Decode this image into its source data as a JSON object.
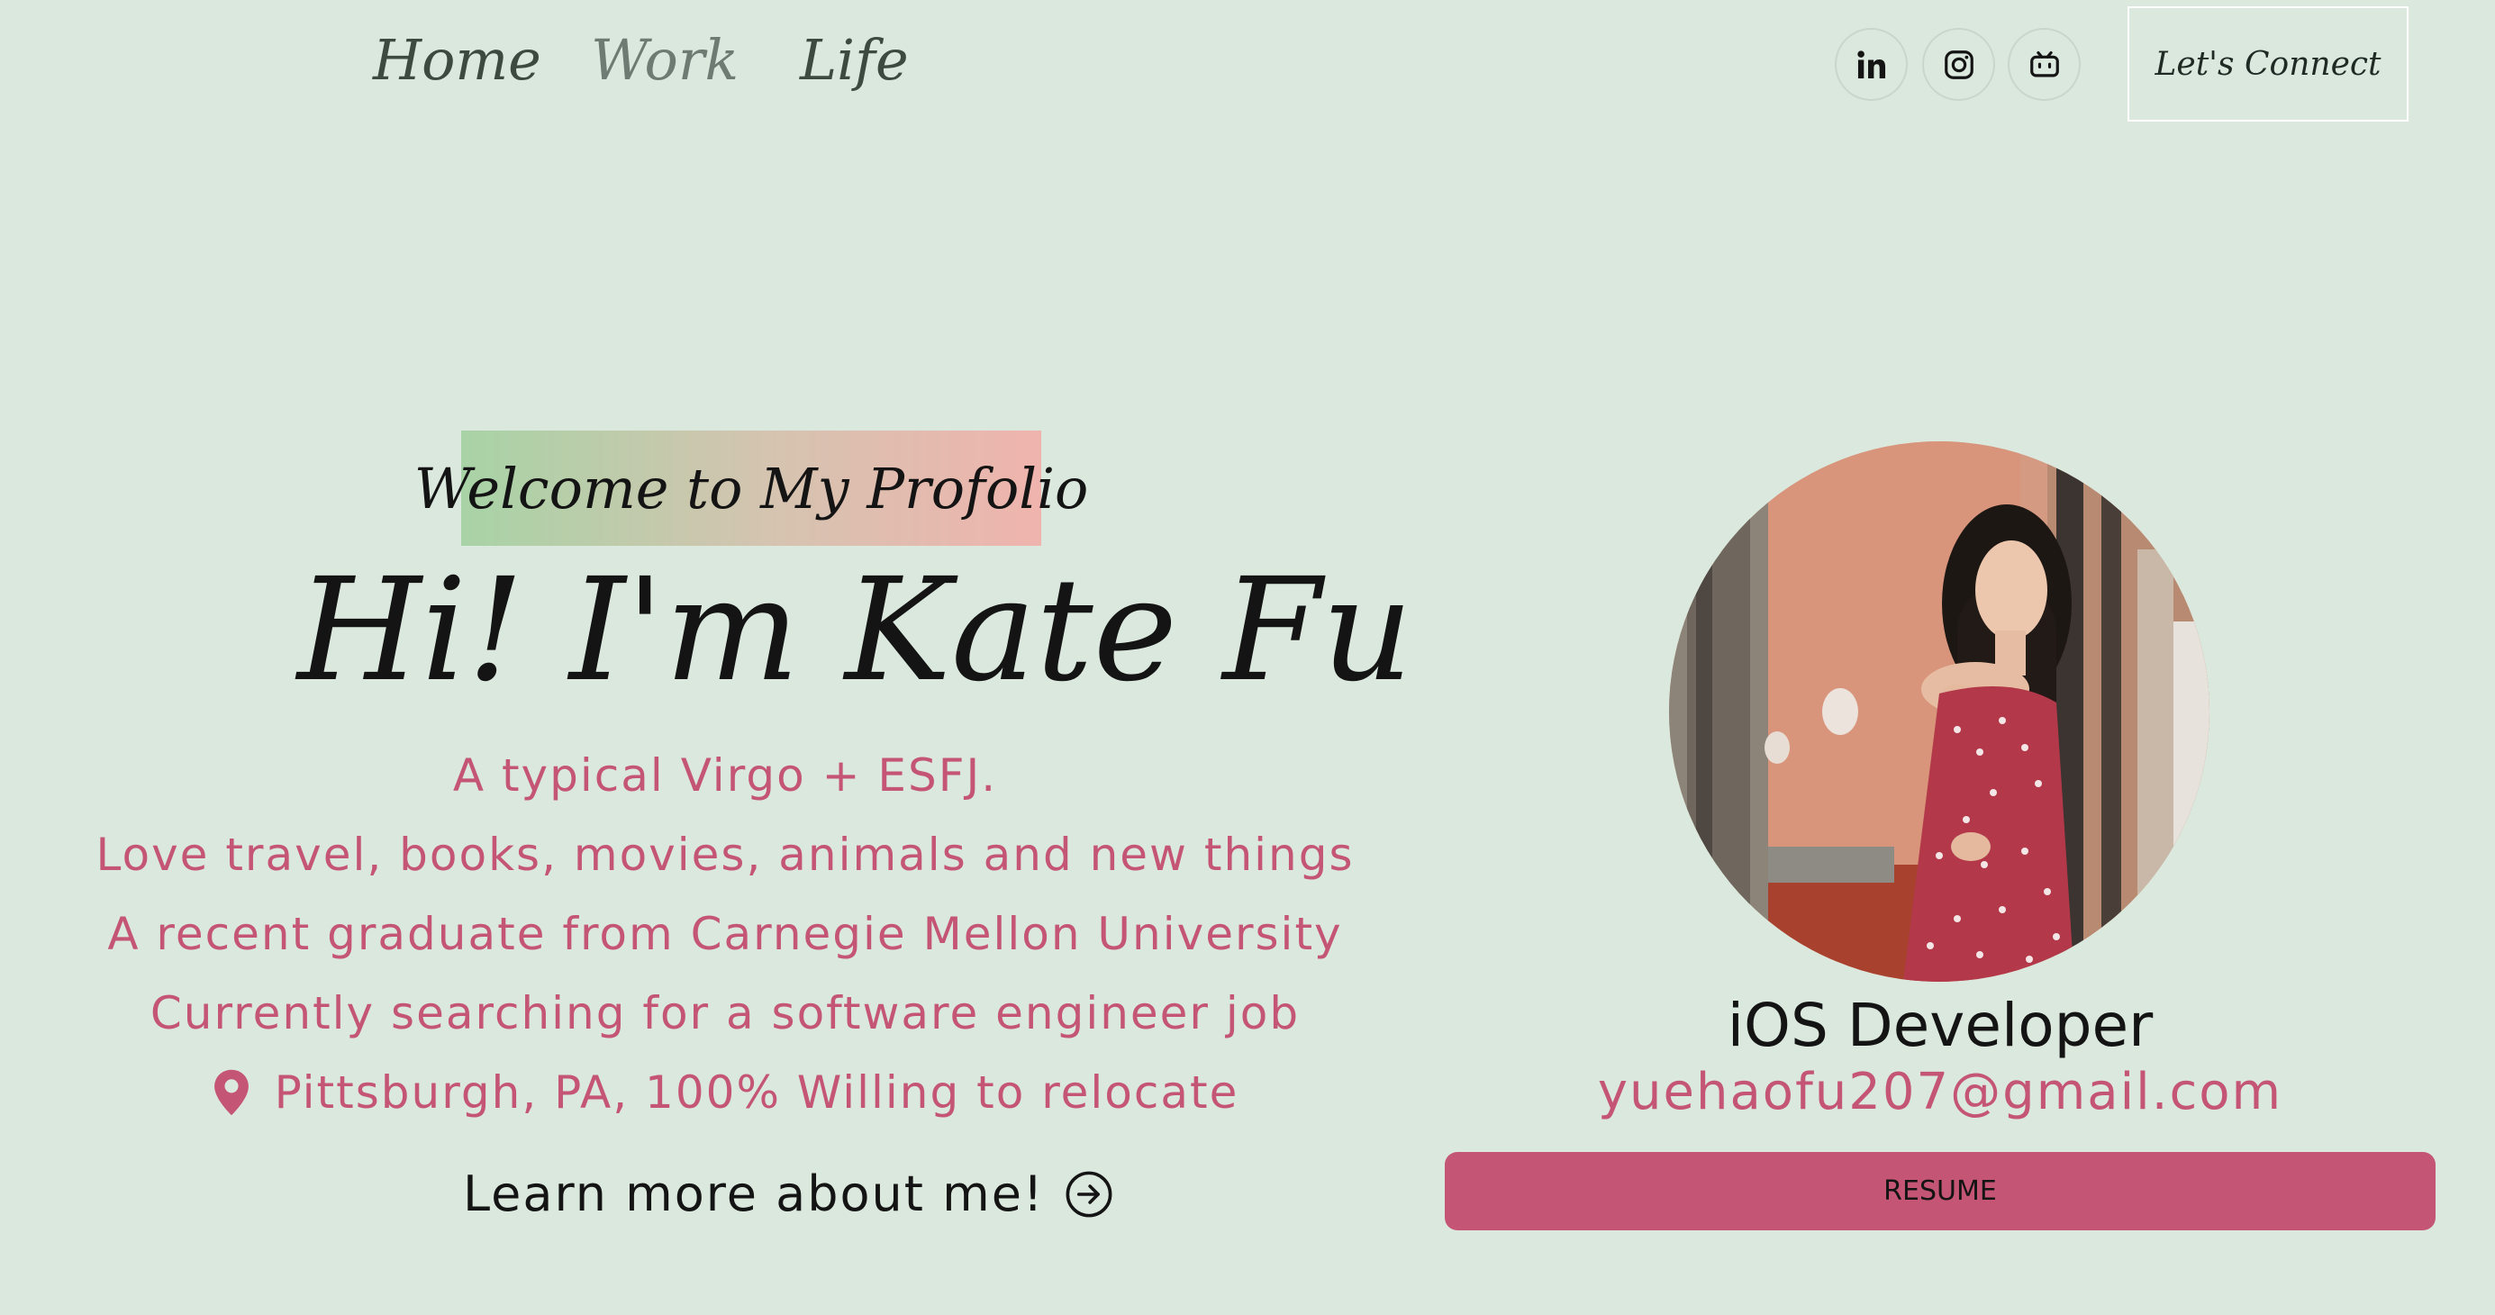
{
  "nav": {
    "items": [
      {
        "label": "Home"
      },
      {
        "label": "Work"
      },
      {
        "label": "Life"
      }
    ],
    "connect_label": "Let's Connect",
    "socials": [
      {
        "icon": "linkedin-icon"
      },
      {
        "icon": "instagram-icon"
      },
      {
        "icon": "bilibili-icon"
      }
    ]
  },
  "hero": {
    "welcome": "Welcome to My Profolio",
    "title": "Hi! I'm Kate Fu",
    "bio": [
      "A typical Virgo + ESFJ.",
      "Love travel, books, movies, animals and new things",
      "A recent graduate from Carnegie Mellon University",
      "Currently searching for a software engineer job"
    ],
    "location": "Pittsburgh, PA, 100% Willing to relocate",
    "learn_more": "Learn more about me!"
  },
  "profile": {
    "role": "iOS Developer",
    "email": "yuehaofu207@gmail.com",
    "resume_label": "RESUME"
  },
  "colors": {
    "background": "#dbe8de",
    "accent": "#c45574",
    "text": "#141414"
  }
}
